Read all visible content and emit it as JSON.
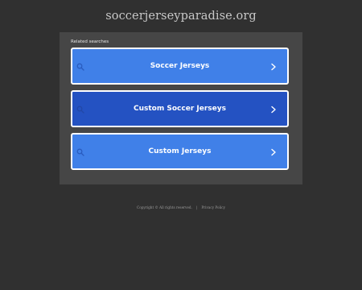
{
  "header": {
    "site_title": "soccerjerseyparadise.org"
  },
  "panel": {
    "label": "Related searches",
    "items": [
      {
        "label": "Soccer Jerseys",
        "icon": "search-icon"
      },
      {
        "label": "Custom Soccer Jerseys",
        "icon": "search-icon"
      },
      {
        "label": "Custom Jerseys",
        "icon": "search-icon"
      }
    ]
  },
  "footer": {
    "copyright": "Copyright © All rights reserved.",
    "separator": "|",
    "privacy": "Privacy Policy"
  },
  "colors": {
    "background": "#303030",
    "panel": "#464646",
    "button": "#4080e8",
    "button_highlighted": "#2452c2",
    "button_border": "#ffffff"
  }
}
